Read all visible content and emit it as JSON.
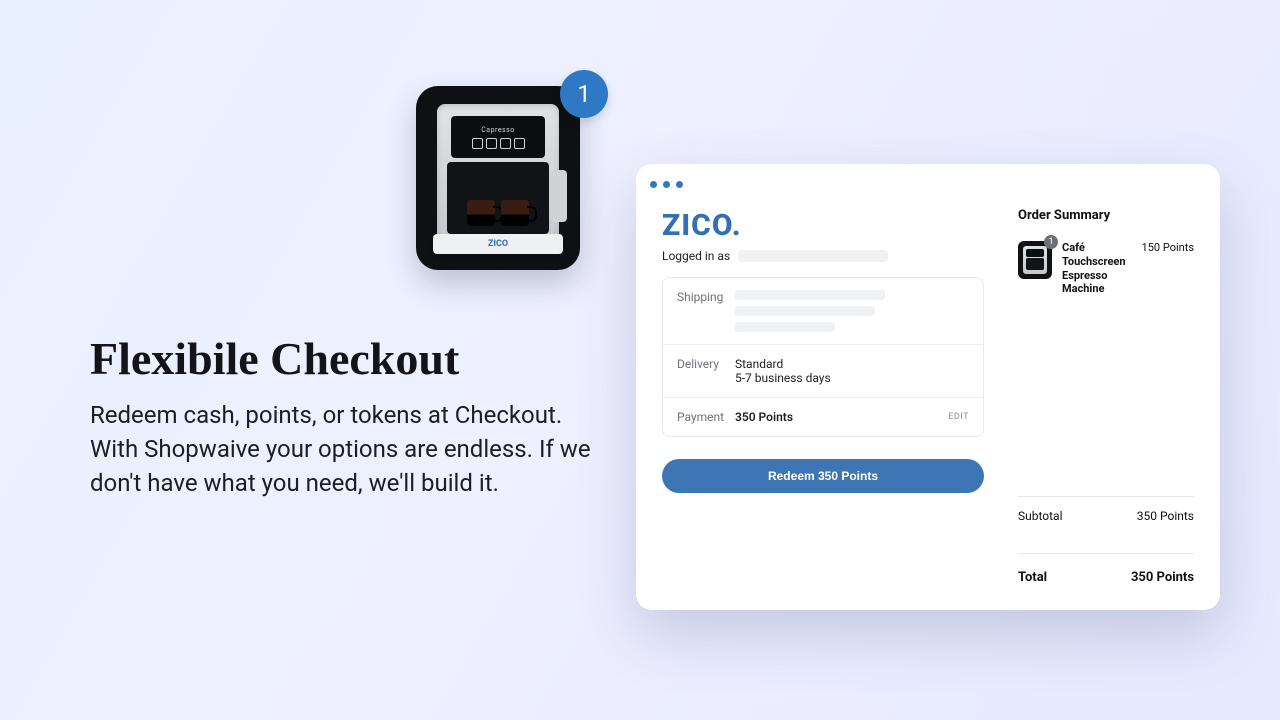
{
  "colors": {
    "accent": "#3e76b5",
    "brand_blue": "#2f78c6"
  },
  "hero": {
    "badge_count": "1",
    "product_brand": "ZICO",
    "headline": "Flexibile Checkout",
    "subcopy": "Redeem cash, points, or tokens at Checkout. With Shopwaive your options are endless. If we don't have what you need, we'll build it."
  },
  "checkout": {
    "brand": "ZICO",
    "logged_in_label": "Logged in as",
    "rows": {
      "shipping_label": "Shipping",
      "delivery_label": "Delivery",
      "delivery_method": "Standard",
      "delivery_eta": "5-7 business days",
      "payment_label": "Payment",
      "payment_value": "350 Points",
      "edit_label": "EDIT"
    },
    "redeem_button": "Redeem 350 Points"
  },
  "order_summary": {
    "title": "Order Summary",
    "item": {
      "qty_badge": "1",
      "name": "Café Touchscreen Espresso Machine",
      "price": "150 Points"
    },
    "subtotal_label": "Subtotal",
    "subtotal_value": "350 Points",
    "total_label": "Total",
    "total_value": "350 Points"
  }
}
